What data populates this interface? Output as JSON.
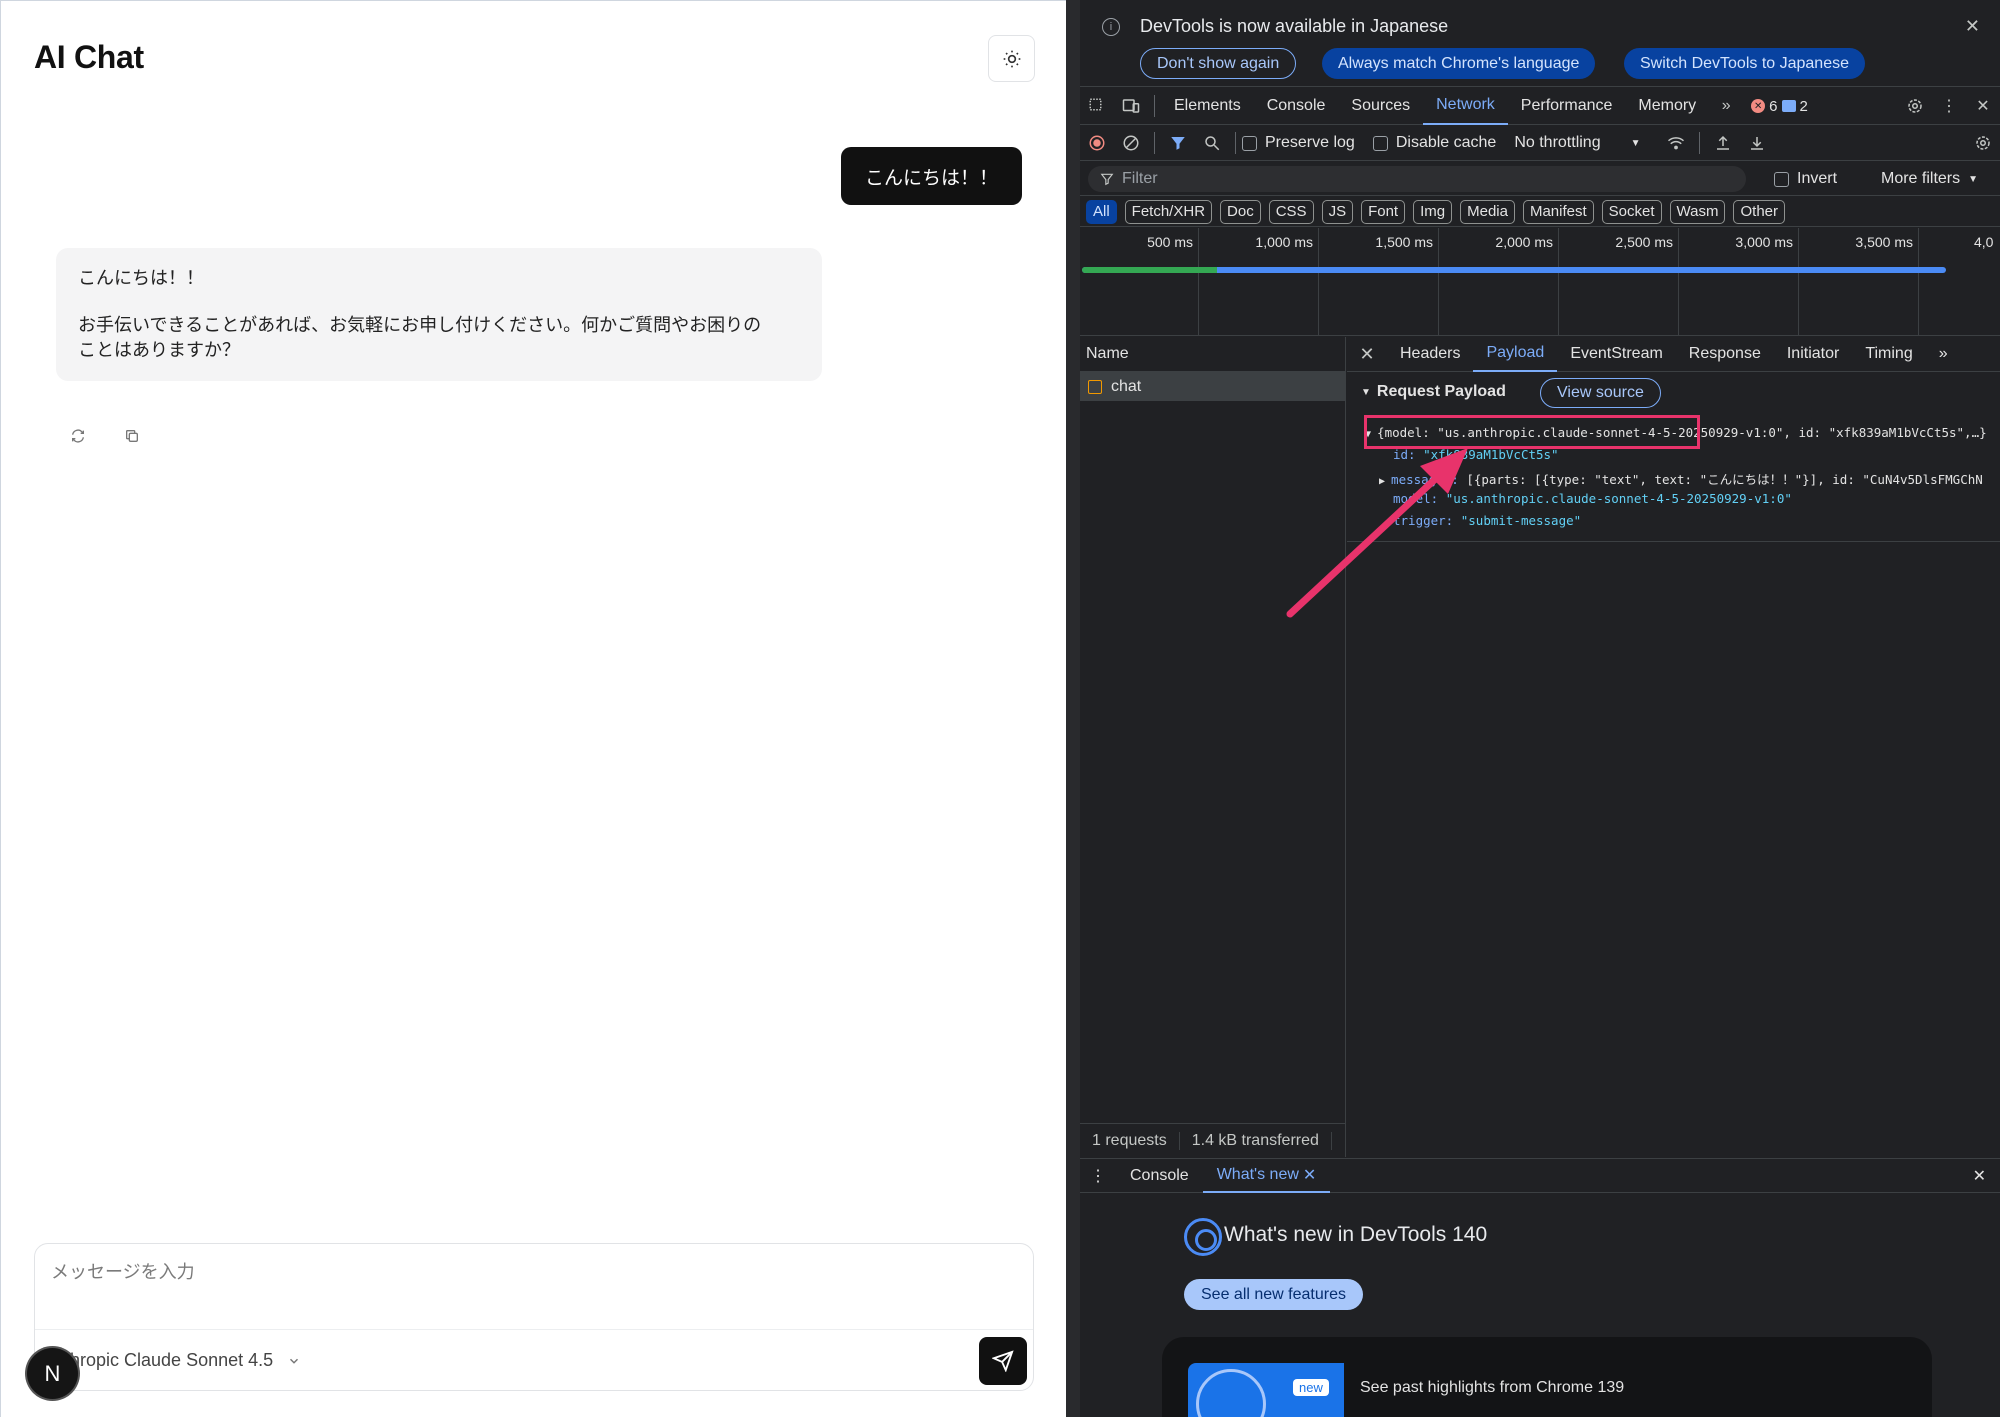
{
  "app": {
    "title": "AI Chat",
    "user_message": "こんにちは！！",
    "ai_message_line1": "こんにちは！！",
    "ai_message_line2": "お手伝いできることがあれば、お気軽にお申し付けください。何かご質問やお困りの",
    "ai_message_line3": "ことはありますか？",
    "composer_placeholder": "メッセージを入力",
    "model_name": "thropic Claude Sonnet 4.5",
    "avatar_letter": "N"
  },
  "devtools": {
    "infobar": {
      "message": "DevTools is now available in Japanese",
      "btn_dont_show": "Don't show again",
      "btn_match": "Always match Chrome's language",
      "btn_switch": "Switch DevTools to Japanese"
    },
    "panels": [
      "Elements",
      "Console",
      "Sources",
      "Network",
      "Performance",
      "Memory"
    ],
    "active_panel": "Network",
    "error_count": "6",
    "message_count": "2",
    "network_toolbar": {
      "preserve_log": "Preserve log",
      "disable_cache": "Disable cache",
      "throttling": "No throttling"
    },
    "filter": {
      "placeholder": "Filter",
      "invert": "Invert",
      "more_filters": "More filters"
    },
    "types": [
      "All",
      "Fetch/XHR",
      "Doc",
      "CSS",
      "JS",
      "Font",
      "Img",
      "Media",
      "Manifest",
      "Socket",
      "Wasm",
      "Other"
    ],
    "timeline_ticks": [
      "500 ms",
      "1,000 ms",
      "1,500 ms",
      "2,000 ms",
      "2,500 ms",
      "3,000 ms",
      "3,500 ms",
      "4,0"
    ],
    "request_list": {
      "header": "Name",
      "rows": [
        "chat"
      ]
    },
    "detail_tabs": [
      "Headers",
      "Payload",
      "EventStream",
      "Response",
      "Initiator",
      "Timing"
    ],
    "active_detail_tab": "Payload",
    "payload": {
      "section_title": "Request Payload",
      "view_source": "View source",
      "summary_line": "{model: \"us.anthropic.claude-sonnet-4-5-20250929-v1:0\", id: \"xfk839aM1bVcCt5s\",…}",
      "id_key": "id:",
      "id_val": "\"xfk839aM1bVcCt5s\"",
      "messages_key": "messages:",
      "messages_val": "[{parts: [{type: \"text\", text: \"こんにちは！！\"}], id: \"CuN4v5DlsFMGChN",
      "model_key": "model:",
      "model_val": "\"us.anthropic.claude-sonnet-4-5-20250929-v1:0\"",
      "trigger_key": "trigger:",
      "trigger_val": "\"submit-message\""
    },
    "status": {
      "requests": "1 requests",
      "transferred": "1.4 kB transferred"
    },
    "drawer": {
      "tabs": [
        "Console",
        "What's new"
      ],
      "active_tab": "What's new",
      "whats_new_title": "What's new in DevTools 140",
      "see_all": "See all new features",
      "new_badge": "new",
      "highlight_text": "See past highlights from Chrome 139"
    },
    "colors": {
      "accent": "#7cacf8",
      "highlight_box": "#e8336b",
      "arrow": "#e8336b"
    }
  }
}
